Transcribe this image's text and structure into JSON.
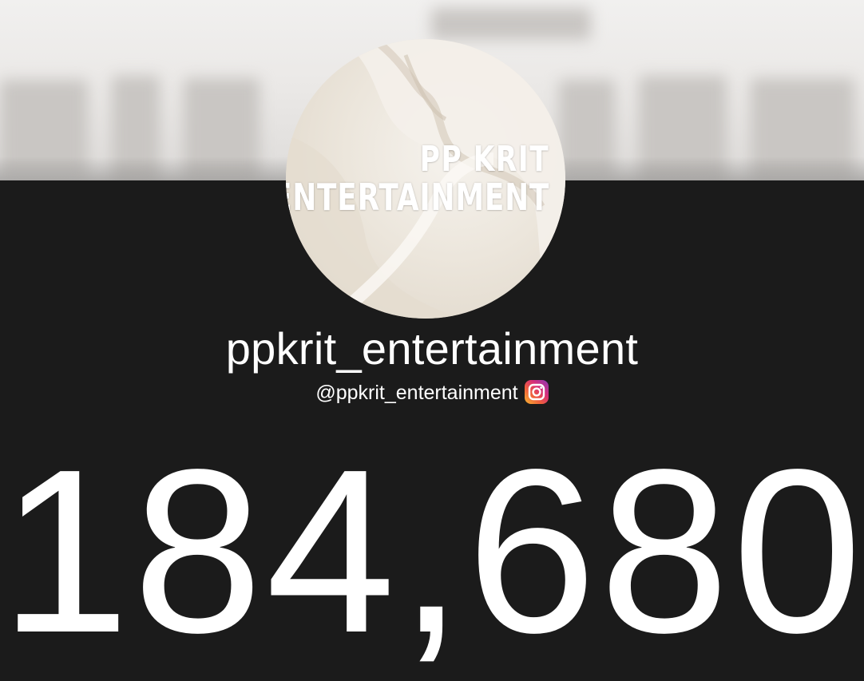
{
  "avatar": {
    "line1": "PP KRIT",
    "line2": "ENTERTAINMENT"
  },
  "profile": {
    "name": "ppkrit_entertainment",
    "handle": "@ppkrit_entertainment",
    "platform_icon": "instagram-icon"
  },
  "follower_count": "184,680",
  "colors": {
    "background": "#1b1b1b",
    "text": "#ffffff"
  }
}
